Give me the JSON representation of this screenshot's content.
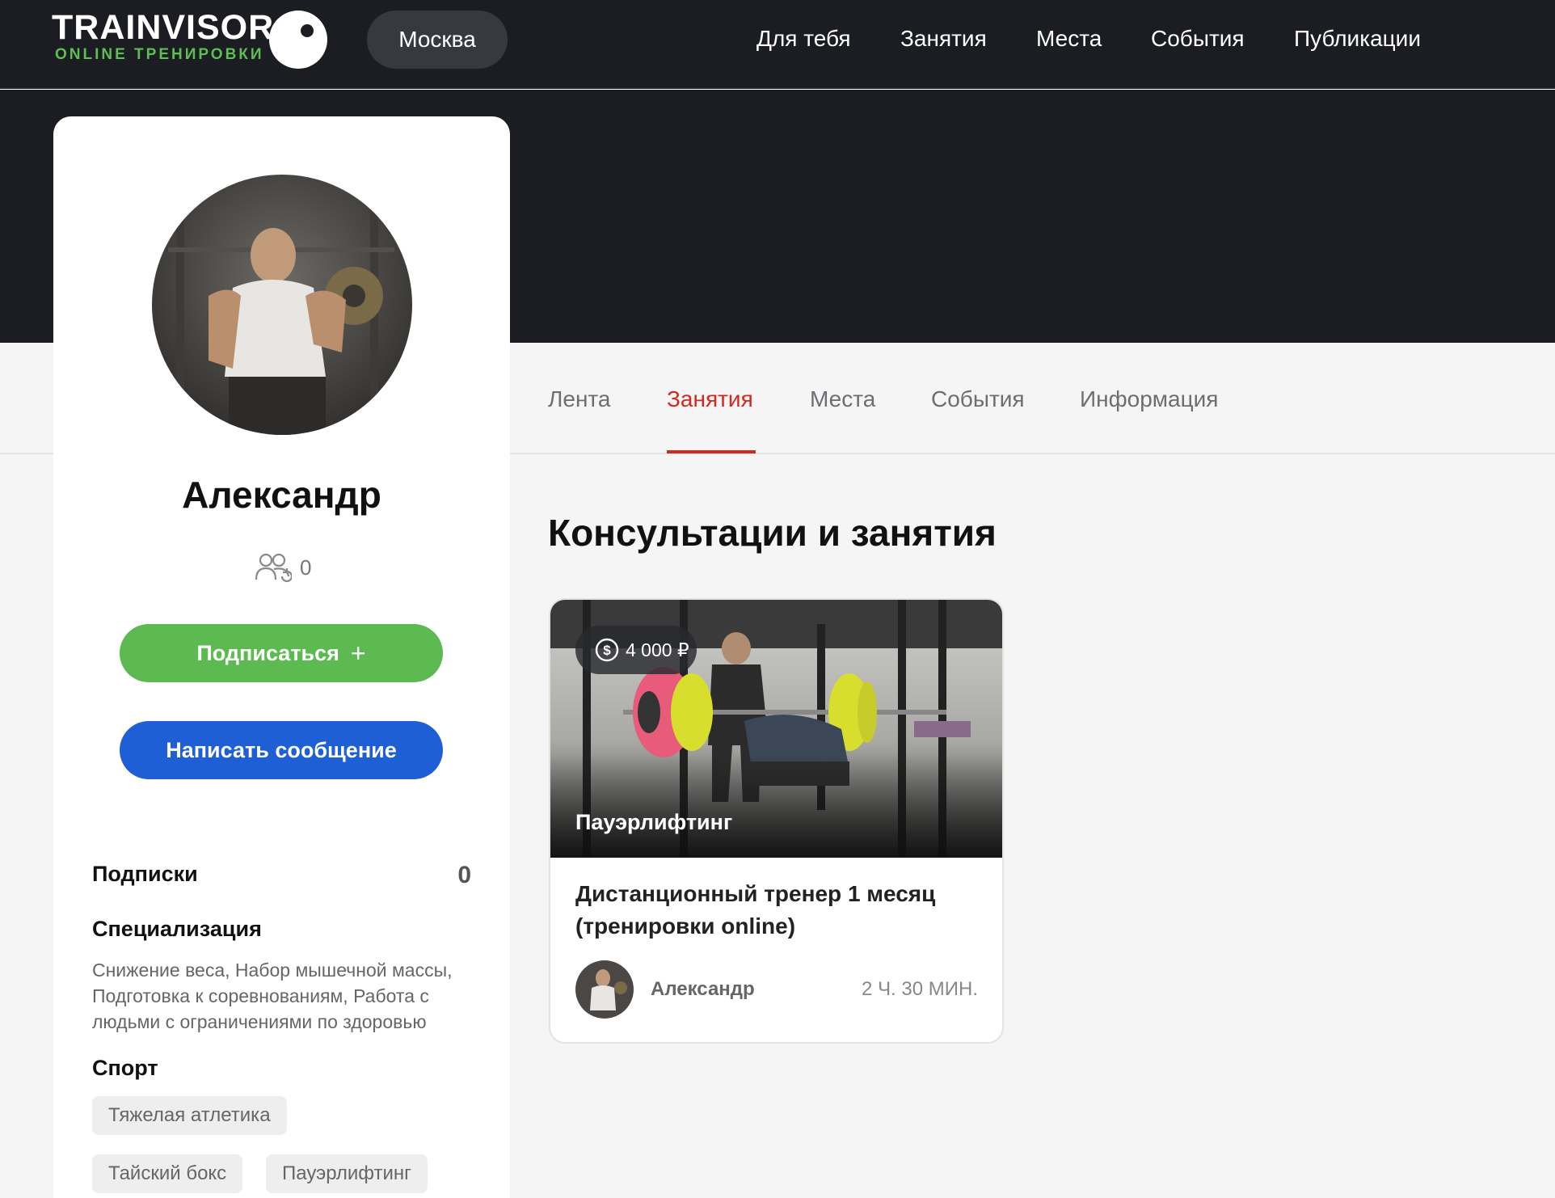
{
  "header": {
    "logo_text": "TRAINVISOR",
    "logo_subtitle": "ONLINE ТРЕНИРОВКИ",
    "city": "Москва",
    "nav": [
      "Для тебя",
      "Занятия",
      "Места",
      "События",
      "Публикации"
    ]
  },
  "profile": {
    "name": "Александр",
    "followers_count": "0",
    "follow_label": "Подписаться",
    "follow_icon": "+",
    "message_label": "Написать сообщение",
    "subscriptions_label": "Подписки",
    "subscriptions_count": "0",
    "specialization_label": "Специализация",
    "specialization_text": "Снижение веса, Набор мышечной массы, Подготовка к соревнованиям, Работа с людьми с ограничениями по здоровью",
    "sport_label": "Спорт",
    "sports": [
      "Тяжелая атлетика",
      "Тайский бокс",
      "Пауэрлифтинг"
    ]
  },
  "tabs": {
    "items": [
      "Лента",
      "Занятия",
      "Места",
      "События",
      "Информация"
    ],
    "active": "Занятия"
  },
  "content": {
    "section_title": "Консультации и занятия",
    "course": {
      "price": "4 000 ₽",
      "category": "Пауэрлифтинг",
      "title": "Дистанционный тренер 1 месяц (тренировки online)",
      "author": "Александр",
      "duration": "2 Ч. 30 МИН."
    }
  },
  "colors": {
    "header_bg": "#1b1d22",
    "accent_red": "#d3281f",
    "follow_green": "#5cba50",
    "message_blue": "#1e5fd6",
    "logo_green": "#5cbf52"
  },
  "icons": {
    "followers": "people-icon",
    "price": "dollar-circle-icon",
    "logo_mark": "eye-icon"
  }
}
